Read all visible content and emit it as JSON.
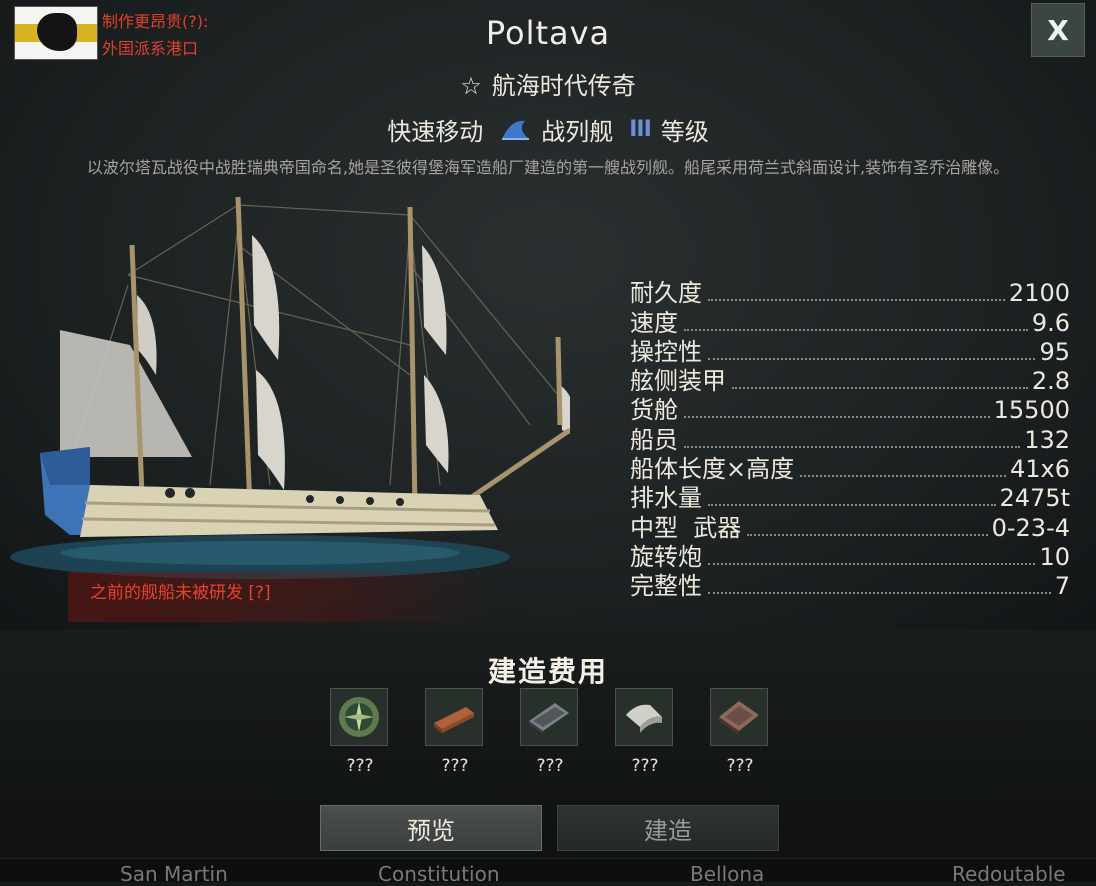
{
  "faction": {
    "line1": "制作更昂贵(?):",
    "line2": "外国派系港口"
  },
  "close_label": "X",
  "ship": {
    "name": "Poltava",
    "era": "航海时代传奇",
    "era_icon": "star-icon",
    "trait": "快速移动",
    "class": "战列舰",
    "class_icon": "sail-icon",
    "tier_icon": "tier-iii-icon",
    "tier_mark": "III",
    "tier_label": "等级",
    "description": "以波尔塔瓦战役中战胜瑞典帝国命名,她是圣彼得堡海军造船厂建造的第一艘战列舰。船尾采用荷兰式斜面设计,装饰有圣乔治雕像。"
  },
  "research_note": "之前的舰船未被研发 [?]",
  "stats": [
    {
      "label": "耐久度",
      "value": "2100"
    },
    {
      "label": "速度",
      "value": "9.6"
    },
    {
      "label": "操控性",
      "value": "95"
    },
    {
      "label": "舷侧装甲",
      "value": "2.8"
    },
    {
      "label": "货舱",
      "value": "15500"
    },
    {
      "label": "船员",
      "value": "132"
    },
    {
      "label": "船体长度×高度",
      "value": "41x6"
    },
    {
      "label": "排水量",
      "value": "2475t"
    },
    {
      "label": "中型  武器",
      "value": "0-23-4"
    },
    {
      "label": "旋转炮",
      "value": "10"
    },
    {
      "label": "完整性",
      "value": "7"
    }
  ],
  "cost": {
    "title": "建造费用",
    "items": [
      {
        "icon": "compass-ornament-icon",
        "qty": "???"
      },
      {
        "icon": "wood-plank-icon",
        "qty": "???"
      },
      {
        "icon": "iron-plate-icon",
        "qty": "???"
      },
      {
        "icon": "canvas-cloth-icon",
        "qty": "???"
      },
      {
        "icon": "copper-sheet-icon",
        "qty": "???"
      }
    ]
  },
  "buttons": {
    "preview": "预览",
    "build": "建造"
  },
  "bottom_names": [
    "San Martin",
    "Constitution",
    "Bellona",
    "Redoutable"
  ]
}
